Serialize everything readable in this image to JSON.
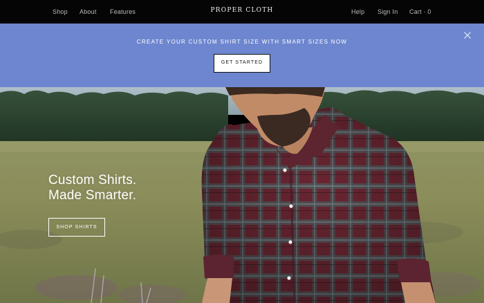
{
  "nav": {
    "left_links": [
      "Shop",
      "About",
      "Features"
    ],
    "brand": "PROPER CLOTH",
    "right_links": [
      "Help",
      "Sign In",
      "Cart · 0"
    ]
  },
  "banner": {
    "message": "CREATE YOUR CUSTOM SHIRT SIZE WITH SMART SIZES NOW",
    "button_label": "GET STARTED",
    "close_icon": "close-icon",
    "background_color": "#6d86cf"
  },
  "hero": {
    "heading_line1": "Custom Shirts.",
    "heading_line2": "Made Smarter.",
    "button_label": "SHOP SHIRTS",
    "image_subject": "hero-photo"
  }
}
